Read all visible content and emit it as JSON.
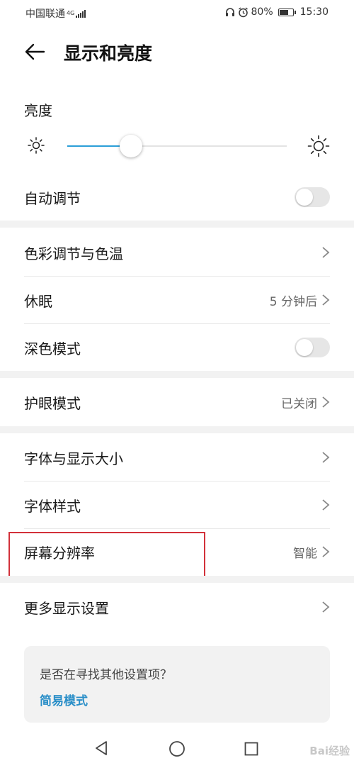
{
  "status_bar": {
    "carrier": "中国联通",
    "network": "4G",
    "battery": "80%",
    "battery_level": 0.8,
    "time": "15:30",
    "icons": [
      "headset-icon",
      "alarm-icon",
      "signal-icon",
      "battery-icon"
    ]
  },
  "header": {
    "title": "显示和亮度",
    "back_icon": "arrow-left-icon"
  },
  "brightness": {
    "label": "亮度",
    "value_fraction": 0.29,
    "accent": "#2b9fd8"
  },
  "rows": {
    "auto_adjust": {
      "label": "自动调节",
      "on": false
    },
    "color_temp": {
      "label": "色彩调节与色温"
    },
    "sleep": {
      "label": "休眠",
      "value": "5 分钟后"
    },
    "dark_mode": {
      "label": "深色模式",
      "on": false
    },
    "eye_comfort": {
      "label": "护眼模式",
      "value": "已关闭"
    },
    "font_size": {
      "label": "字体与显示大小"
    },
    "font_style": {
      "label": "字体样式"
    },
    "resolution": {
      "label": "屏幕分辨率",
      "value": "智能"
    },
    "more_display": {
      "label": "更多显示设置"
    }
  },
  "suggestion_card": {
    "question": "是否在寻找其他设置项？",
    "link": "简易模式",
    "link_color": "#2b8fc8"
  },
  "highlight_color": "#d2313a",
  "watermark": "Bai经验"
}
